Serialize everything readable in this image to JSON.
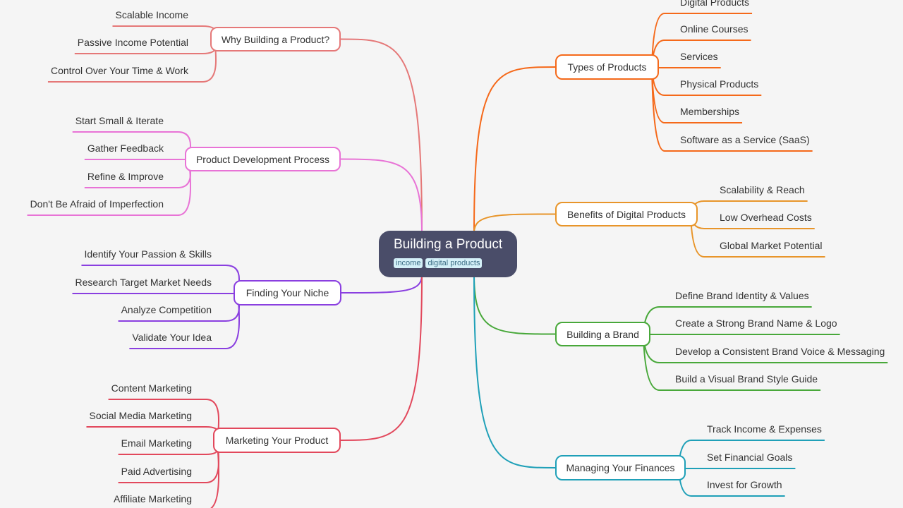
{
  "central": {
    "title": "Building a Product",
    "tags": [
      "income",
      "digital products"
    ]
  },
  "branches": [
    {
      "label": "Why Building a Product?",
      "side": "left",
      "color": "#e57878",
      "leaves": [
        "Scalable Income",
        "Passive Income Potential",
        "Control Over Your Time & Work"
      ]
    },
    {
      "label": "Product Development Process",
      "side": "left",
      "color": "#e873d6",
      "leaves": [
        "Start Small & Iterate",
        "Gather Feedback",
        "Refine & Improve",
        "Don't Be Afraid of Imperfection"
      ]
    },
    {
      "label": "Finding Your Niche",
      "side": "left",
      "color": "#8a3fe0",
      "leaves": [
        "Identify Your Passion & Skills",
        "Research Target Market Needs",
        "Analyze Competition",
        "Validate Your Idea"
      ]
    },
    {
      "label": "Marketing Your Product",
      "side": "left",
      "color": "#e2485c",
      "leaves": [
        "Content Marketing",
        "Social Media Marketing",
        "Email Marketing",
        "Paid Advertising",
        "Affiliate Marketing"
      ]
    },
    {
      "label": "Types of Products",
      "side": "right",
      "color": "#f5691a",
      "leaves": [
        "Digital Products",
        "Online Courses",
        "Services",
        "Physical Products",
        "Memberships",
        "Software as a Service (SaaS)"
      ]
    },
    {
      "label": "Benefits of Digital Products",
      "side": "right",
      "color": "#e8952a",
      "leaves": [
        "Scalability & Reach",
        "Low Overhead Costs",
        "Global Market Potential"
      ]
    },
    {
      "label": "Building a Brand",
      "side": "right",
      "color": "#48a83a",
      "leaves": [
        "Define Brand Identity & Values",
        "Create a Strong Brand Name & Logo",
        "Develop a Consistent Brand Voice & Messaging",
        "Build a Visual Brand Style Guide"
      ]
    },
    {
      "label": "Managing Your Finances",
      "side": "right",
      "color": "#1fa0b8",
      "leaves": [
        "Track Income & Expenses",
        "Set Financial Goals",
        "Invest for Growth"
      ]
    }
  ]
}
